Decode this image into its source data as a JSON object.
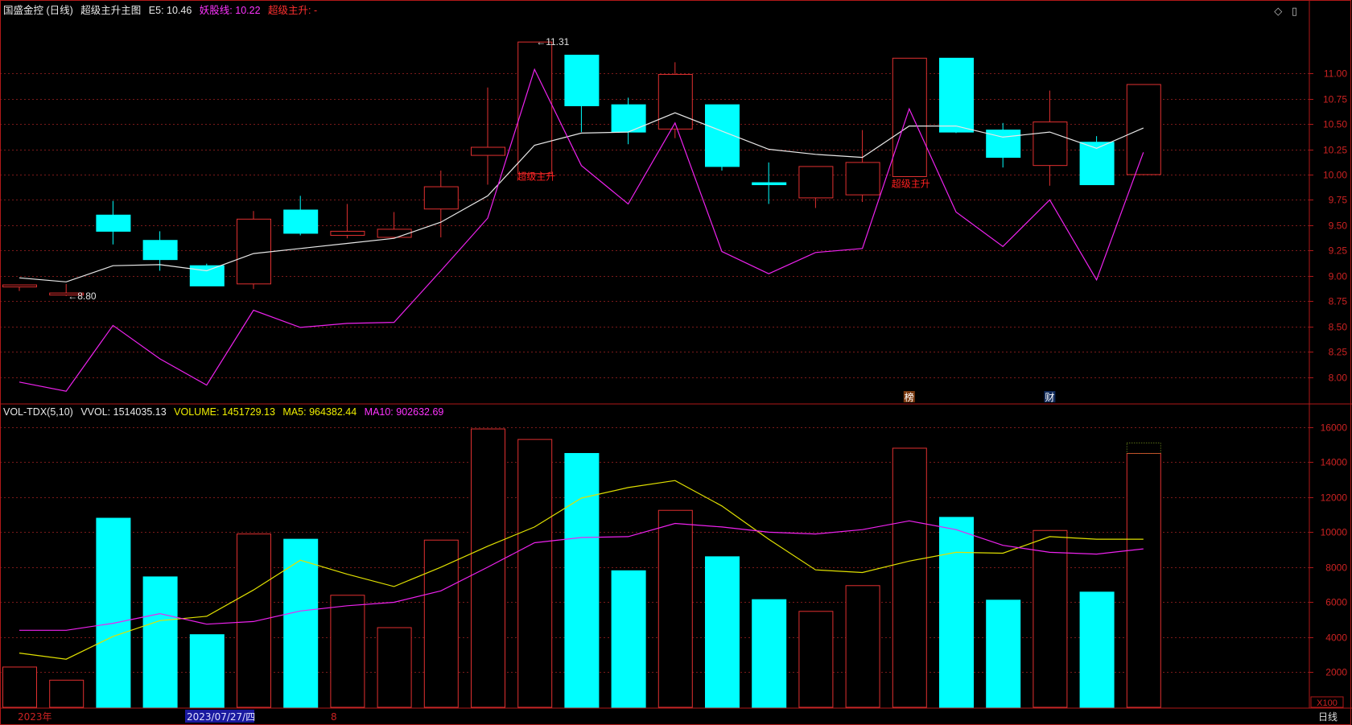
{
  "header": {
    "stock_name": "国盛金控 (日线)",
    "indicator": "超级主升主图",
    "e5": "E5: 10.46",
    "yaogu_label": "妖股线: 10.22",
    "superrise_label": "超级主升: -"
  },
  "vol_header": {
    "name": "VOL-TDX(5,10)",
    "vvol": "VVOL: 1514035.13",
    "volume": "VOLUME: 1451729.13",
    "ma5": "MA5: 964382.44",
    "ma10": "MA10: 902632.69"
  },
  "icons": [
    "diamond-icon",
    "panel-icon"
  ],
  "colors": {
    "up": "#e03030",
    "down": "#00ffff",
    "e5": "#e8e8e8",
    "yaogu": "#ee22ee",
    "ma5": "#e0e000",
    "ma10": "#ee22ee",
    "grid": "#7a1a1a",
    "border": "#b01818",
    "axis_text": "#cc2222"
  },
  "chart_data": [
    {
      "type": "candlestick",
      "title": "国盛金控 (日线)",
      "y_ticks": [
        "8.00",
        "8.25",
        "8.50",
        "8.75",
        "9.00",
        "9.25",
        "9.50",
        "9.75",
        "10.00",
        "10.25",
        "10.50",
        "10.75",
        "11.00"
      ],
      "ylim": [
        7.75,
        11.55
      ],
      "grid": true,
      "candles": [
        {
          "o": 8.89,
          "h": 8.91,
          "l": 8.85,
          "c": 8.91
        },
        {
          "o": 8.81,
          "h": 8.92,
          "l": 8.8,
          "c": 8.83
        },
        {
          "o": 9.6,
          "h": 9.74,
          "l": 9.31,
          "c": 9.44
        },
        {
          "o": 9.35,
          "h": 9.44,
          "l": 9.05,
          "c": 9.16
        },
        {
          "o": 9.1,
          "h": 9.12,
          "l": 8.9,
          "c": 8.9
        },
        {
          "o": 8.92,
          "h": 9.64,
          "l": 8.87,
          "c": 9.56
        },
        {
          "o": 9.65,
          "h": 9.79,
          "l": 9.4,
          "c": 9.42
        },
        {
          "o": 9.4,
          "h": 9.71,
          "l": 9.37,
          "c": 9.44
        },
        {
          "o": 9.38,
          "h": 9.63,
          "l": 9.37,
          "c": 9.46
        },
        {
          "o": 9.66,
          "h": 10.04,
          "l": 9.38,
          "c": 9.88
        },
        {
          "o": 10.19,
          "h": 10.86,
          "l": 9.9,
          "c": 10.27
        },
        {
          "o": 10.01,
          "h": 11.31,
          "l": 10.0,
          "c": 11.31
        },
        {
          "o": 11.18,
          "h": 11.18,
          "l": 10.42,
          "c": 10.68
        },
        {
          "o": 10.69,
          "h": 10.76,
          "l": 10.3,
          "c": 10.42
        },
        {
          "o": 10.45,
          "h": 11.11,
          "l": 10.36,
          "c": 10.99
        },
        {
          "o": 10.69,
          "h": 10.69,
          "l": 10.04,
          "c": 10.08
        },
        {
          "o": 9.92,
          "h": 10.12,
          "l": 9.71,
          "c": 9.9
        },
        {
          "o": 9.77,
          "h": 10.07,
          "l": 9.67,
          "c": 10.08
        },
        {
          "o": 9.8,
          "h": 10.44,
          "l": 9.73,
          "c": 10.12
        },
        {
          "o": 9.98,
          "h": 11.15,
          "l": 9.98,
          "c": 11.15
        },
        {
          "o": 11.15,
          "h": 11.15,
          "l": 10.41,
          "c": 10.42
        },
        {
          "o": 10.44,
          "h": 10.51,
          "l": 10.07,
          "c": 10.17
        },
        {
          "o": 10.09,
          "h": 10.83,
          "l": 9.89,
          "c": 10.52
        },
        {
          "o": 10.32,
          "h": 10.38,
          "l": 9.9,
          "c": 9.9
        },
        {
          "o": 10.0,
          "h": 10.89,
          "l": 10.0,
          "c": 10.89
        }
      ],
      "series": [
        {
          "name": "E5",
          "values": [
            8.98,
            8.94,
            9.1,
            9.11,
            9.05,
            9.22,
            9.27,
            9.32,
            9.37,
            9.53,
            9.79,
            10.29,
            10.41,
            10.42,
            10.61,
            10.43,
            10.25,
            10.2,
            10.17,
            10.48,
            10.48,
            10.37,
            10.42,
            10.26,
            10.46
          ]
        },
        {
          "name": "妖股线",
          "values": [
            7.95,
            7.86,
            8.51,
            8.18,
            7.92,
            8.66,
            8.49,
            8.53,
            8.54,
            9.05,
            9.57,
            11.04,
            10.09,
            9.71,
            10.51,
            9.24,
            9.02,
            9.23,
            9.27,
            10.65,
            9.63,
            9.29,
            9.75,
            8.96,
            10.22
          ]
        }
      ],
      "annotations": [
        {
          "text": "←8.80",
          "bar": 1,
          "value": 8.8
        },
        {
          "text": "←11.31",
          "bar": 11,
          "value": 11.31
        },
        {
          "text": "超级主升",
          "bar": 11,
          "value": 9.98
        },
        {
          "text": "超级主升",
          "bar": 19,
          "value": 9.91
        }
      ],
      "markers": [
        {
          "text": "榜",
          "bar": 19
        },
        {
          "text": "财",
          "bar": 22
        }
      ]
    },
    {
      "type": "bar",
      "title": "VOL-TDX(5,10)",
      "y_ticks": [
        "2000",
        "4000",
        "6000",
        "8000",
        "10000",
        "12000",
        "14000",
        "16000"
      ],
      "ylim": [
        0,
        16500
      ],
      "unit_label": "X100",
      "values": [
        2300,
        1550,
        10800,
        7450,
        4150,
        9900,
        9600,
        6400,
        4550,
        9550,
        15900,
        15300,
        14500,
        7800,
        11250,
        8600,
        6150,
        5480,
        6950,
        14800,
        10850,
        6120,
        10100,
        6580,
        14500
      ],
      "last_bar_forecast": 15100,
      "directions": [
        "up",
        "up",
        "down",
        "down",
        "down",
        "up",
        "down",
        "up",
        "up",
        "up",
        "up",
        "up",
        "down",
        "down",
        "up",
        "down",
        "down",
        "up",
        "up",
        "up",
        "down",
        "down",
        "up",
        "down",
        "up"
      ],
      "series": [
        {
          "name": "MA5",
          "values": [
            3100,
            2750,
            4050,
            4950,
            5200,
            6700,
            8400,
            7600,
            6900,
            8000,
            9200,
            10300,
            11950,
            12550,
            12950,
            11500,
            9600,
            7850,
            7700,
            8350,
            8850,
            8800,
            9750,
            9600,
            9600
          ]
        },
        {
          "name": "MA10",
          "values": [
            4400,
            4400,
            4800,
            5350,
            4750,
            4900,
            5500,
            5800,
            6000,
            6650,
            8000,
            9400,
            9700,
            9750,
            10500,
            10300,
            10000,
            9900,
            10150,
            10650,
            10150,
            9250,
            8850,
            8750,
            9050
          ]
        }
      ],
      "x_labels": [
        "2023年",
        "2023/07/27/四",
        "8"
      ],
      "period_label": "日线"
    }
  ]
}
